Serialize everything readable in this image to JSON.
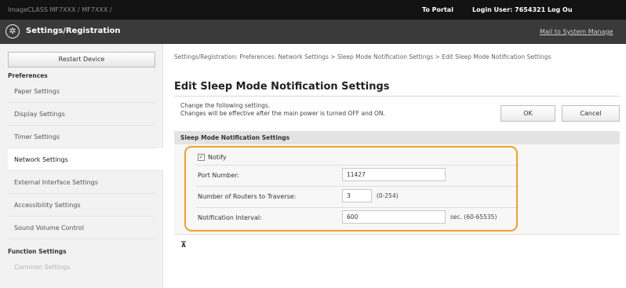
{
  "topbar": {
    "device_name": "ImageCLASS      MF7XXX / MF7XXX /",
    "portal_link": "To Portal",
    "login_label": "Login User:",
    "login_user": "7654321",
    "logout": "Log Ou"
  },
  "header": {
    "logo_icon": "settings-gear-icon",
    "title": "Settings/Registration",
    "mail_link": "Mail to System Manage"
  },
  "sidebar": {
    "restart_label": "Restart Device",
    "preferences_heading": "Preferences",
    "preferences_items": [
      {
        "label": "Paper Settings"
      },
      {
        "label": "Display Settings"
      },
      {
        "label": "Timer Settings"
      },
      {
        "label": "Network Settings"
      },
      {
        "label": "External Interface Settings"
      },
      {
        "label": "Accessibility Settings"
      },
      {
        "label": "Sound Volume Control"
      }
    ],
    "function_heading": "Function Settings",
    "function_items": [
      {
        "label": "Common Settings"
      }
    ]
  },
  "main": {
    "breadcrumb": "Settings/Registration: Preferences: Network Settings > Sleep Mode Notification Settings > Edit Sleep Mode Notification Settings",
    "title": "Edit Sleep Mode Notification Settings",
    "desc_line1": "Change the following settings.",
    "desc_line2": "Changes will be effective after the main power is turned OFF and ON.",
    "ok_label": "OK",
    "cancel_label": "Cancel",
    "section_title": "Sleep Mode Notification Settings",
    "notify_label": "Notify",
    "notify_checked": true,
    "checkmark": "✓",
    "port_label": "Port Number:",
    "port_value": "11427",
    "routers_label": "Number of Routers to Traverse:",
    "routers_value": "3",
    "routers_range": "(0-254)",
    "interval_label": "Notification Interval:",
    "interval_value": "600",
    "interval_range": "sec. (60-65535)",
    "top_link": "⊼"
  },
  "colors": {
    "topbar": "#121212",
    "header": "#3a3a3a",
    "highlight": "#f2a11f",
    "section_bar": "#e3e3e3"
  }
}
